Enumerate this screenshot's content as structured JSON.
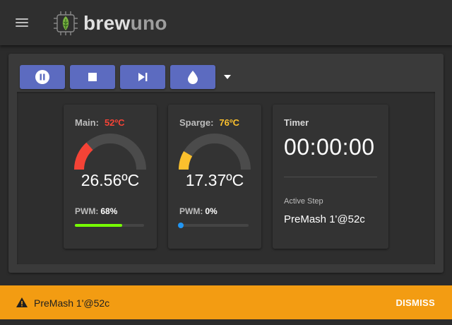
{
  "app": {
    "name_part1": "brew",
    "name_part2": "uno",
    "logo_icon": "hop-chip-icon",
    "menu_icon": "hamburger-menu-icon"
  },
  "colors": {
    "accent": "#5c6bc0",
    "main_temp_color": "#f44336",
    "sparge_temp_color": "#fbc02d",
    "pwm_fill": "#76ff03",
    "snackbar_bg": "#f39c12"
  },
  "toolbar": {
    "buttons": [
      {
        "icon": "pause-circle-icon"
      },
      {
        "icon": "stop-icon"
      },
      {
        "icon": "skip-next-icon"
      },
      {
        "icon": "water-drop-icon"
      }
    ],
    "more_icon": "caret-down-icon"
  },
  "main_sensor": {
    "label": "Main:",
    "setpoint": "52ºC",
    "temperature": "26.56ºC",
    "pwm_label": "PWM:",
    "pwm_value": "68%",
    "pwm_fraction": 0.68,
    "gauge_fraction": 0.27
  },
  "sparge_sensor": {
    "label": "Sparge:",
    "setpoint": "76ºC",
    "temperature": "17.37ºC",
    "pwm_label": "PWM:",
    "pwm_value": "0%",
    "pwm_fraction": 0,
    "gauge_fraction": 0.17
  },
  "timer": {
    "label": "Timer",
    "value": "00:00:00",
    "active_step_label": "Active Step",
    "active_step": "PreMash 1'@52c"
  },
  "notification": {
    "icon": "warning-icon",
    "message": "PreMash 1'@52c",
    "action": "DISMISS"
  }
}
